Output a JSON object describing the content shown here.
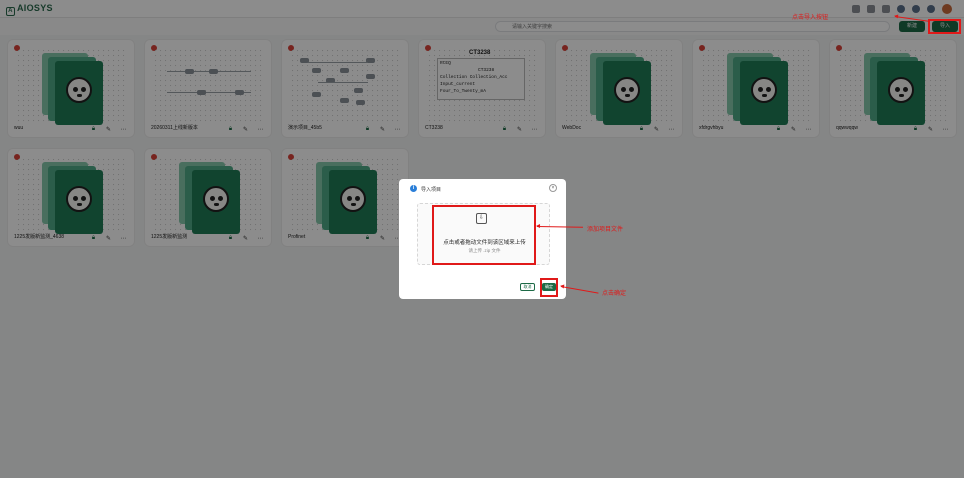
{
  "app": {
    "logo_text": "AIOSYS"
  },
  "search": {
    "placeholder": "请输入关键字搜索"
  },
  "toolbar": {
    "new_label": "新建",
    "import_label": "导入"
  },
  "projects": [
    {
      "name": "wuu",
      "preview": "panda"
    },
    {
      "name": "20260311上线新版本",
      "preview": "diagram"
    },
    {
      "name": "演示项目_45b5",
      "preview": "flow"
    },
    {
      "name": "CT3238",
      "preview": "ct"
    },
    {
      "name": "WebDoc",
      "preview": "panda"
    },
    {
      "name": "xfdrgvhbyu",
      "preview": "panda"
    },
    {
      "name": "qqwwqqw",
      "preview": "panda"
    },
    {
      "name": "1225发版新监测_4638",
      "preview": "panda"
    },
    {
      "name": "1225发版新监测",
      "preview": "panda"
    },
    {
      "name": "Profinet",
      "preview": "panda"
    }
  ],
  "ct_preview": {
    "title": "CT3238",
    "lines": [
      "RtEQ",
      "CT3238",
      "Collection    Collection_Acc",
      "Input_current",
      "Four_To_Twenty_mA"
    ]
  },
  "dialog": {
    "title": "导入项目",
    "drop_text": "点击或者拖动文件到该区域来上传",
    "drop_hint": "请上传 .zip 文件",
    "cancel_label": "取消",
    "ok_label": "确定"
  },
  "annotations": {
    "import_note": "点击导入按钮",
    "add_note": "添加项目文件",
    "confirm_note": "点击确定"
  },
  "colors": {
    "brand": "#1d6a46",
    "annotation": "#e01919",
    "status_dot": "#d9423a"
  }
}
